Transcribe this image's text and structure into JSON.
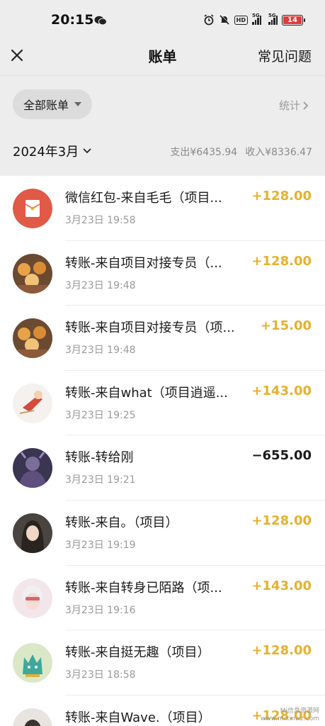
{
  "status": {
    "time": "20:15",
    "battery": "14",
    "hd": "HD",
    "net1": "5G",
    "net2": "5G"
  },
  "nav": {
    "title": "账单",
    "faq": "常见问题"
  },
  "filter": {
    "label": "全部账单",
    "stats": "统计"
  },
  "month": {
    "label": "2024年3月",
    "expense": "支出¥6435.94",
    "income": "收入¥8336.47"
  },
  "transactions": [
    {
      "title": "微信红包-来自毛毛（项目...",
      "time": "3月23日 19:58",
      "amount": "+128.00"
    },
    {
      "title": "转账-来自项目对接专员（...",
      "time": "3月23日 19:48",
      "amount": "+128.00"
    },
    {
      "title": "转账-来自项目对接专员（项...",
      "time": "3月23日 19:48",
      "amount": "+15.00"
    },
    {
      "title": "转账-来自what（项目逍遥...",
      "time": "3月23日 19:25",
      "amount": "+143.00"
    },
    {
      "title": "转账-转给刚",
      "time": "3月23日 19:21",
      "amount": "−655.00"
    },
    {
      "title": "转账-来自。（项目）",
      "time": "3月23日 19:19",
      "amount": "+128.00"
    },
    {
      "title": "转账-来自转身已陌路（项...",
      "time": "3月23日 19:16",
      "amount": "+143.00"
    },
    {
      "title": "转账-来自挺无趣（项目）",
      "time": "3月23日 18:58",
      "amount": "+128.00"
    },
    {
      "title": "转账-来自Wave.（项目）",
      "time": "",
      "amount": "+128.00"
    }
  ],
  "colors": {
    "income": "#e6b12c",
    "expense": "#1a1a1a",
    "header_bg": "#ededed",
    "red_packet": "#e05a47"
  },
  "watermark": {
    "line1": "Mi信息资源网",
    "line2": "www.mixinwz.com"
  }
}
